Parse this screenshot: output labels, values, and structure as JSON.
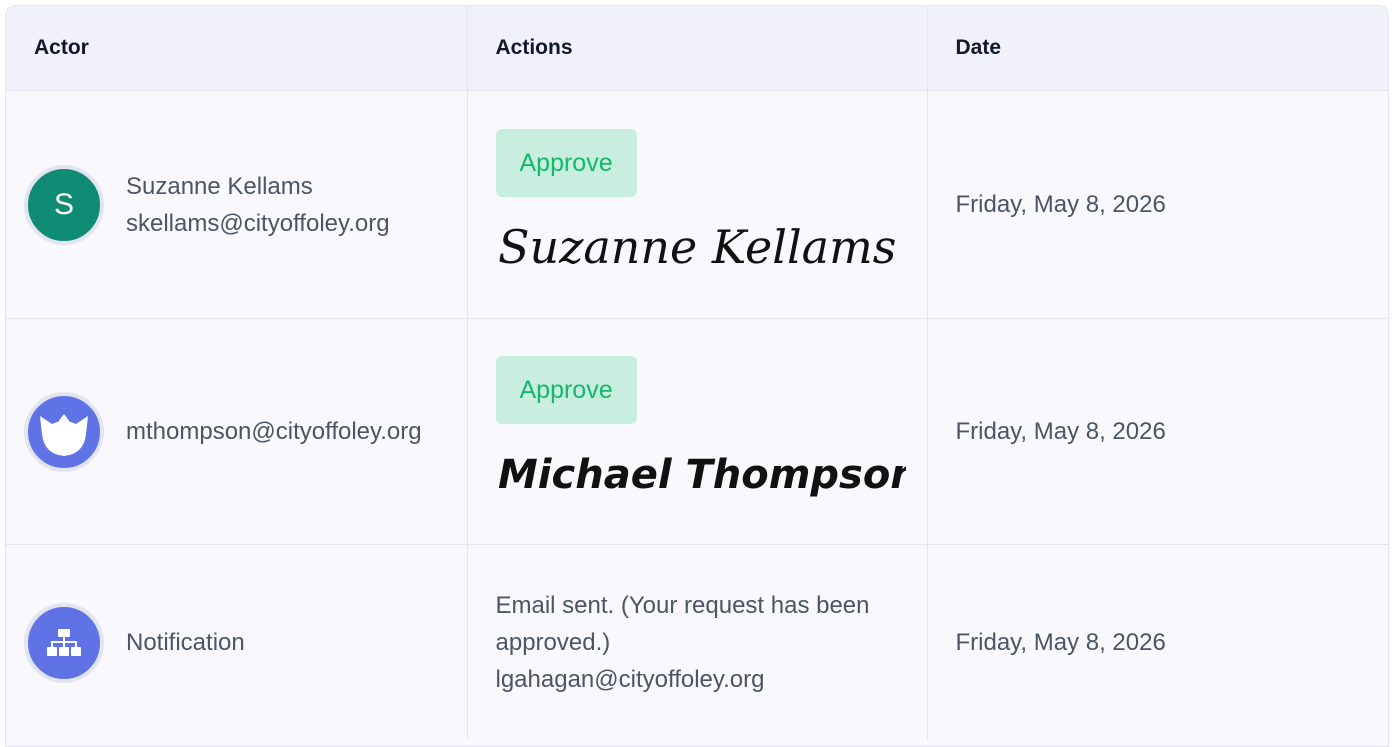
{
  "table": {
    "headers": {
      "actor": "Actor",
      "actions": "Actions",
      "date": "Date"
    },
    "rows": [
      {
        "avatar_letter": "S",
        "avatar_color": "#0f8a73",
        "actor_name": "Suzanne Kellams",
        "actor_email": "skellams@cityoffoley.org",
        "action_badge": "Approve",
        "signature": "Suzanne Kellams",
        "date": "Friday, May 8, 2026"
      },
      {
        "avatar_icon": "cat-face-icon",
        "avatar_color": "#5f73e6",
        "actor_email": "mthompson@cityoffoley.org",
        "action_badge": "Approve",
        "signature": "Michael Thompson",
        "date": "Friday, May 8, 2026"
      },
      {
        "avatar_icon": "sitemap-icon",
        "avatar_color": "#5f73e6",
        "actor_name": "Notification",
        "action_text_1": "Email sent. (Your request has been approved.)",
        "action_text_2": "lgahagan@cityoffoley.org",
        "date": "Friday, May 8, 2026"
      }
    ]
  },
  "colors": {
    "badge_bg": "#c8eedf",
    "badge_text": "#14b86a",
    "header_bg": "#f0f1fb",
    "row_bg": "#f8f8fd"
  }
}
